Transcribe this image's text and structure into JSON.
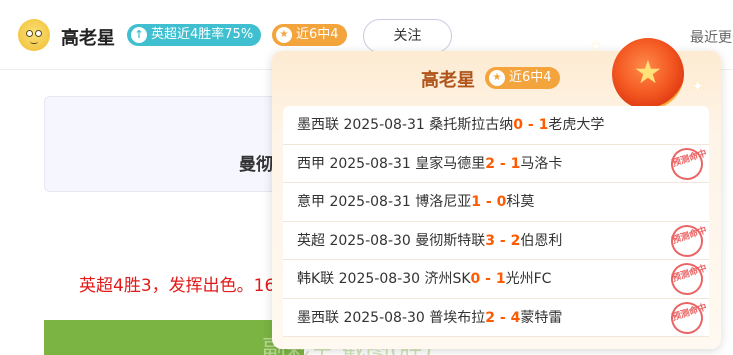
{
  "header": {
    "user_name": "高老星",
    "badge_rate": "英超近4胜率75%",
    "badge_streak": "近6中4",
    "follow_label": "关注",
    "recent_label": "最近更"
  },
  "background": {
    "card_text": "曼彻",
    "red_text": "英超4胜3，发挥出色。16",
    "green_text": "副彩生 截图(胜)"
  },
  "popup": {
    "name": "高老星",
    "badge": "近6中4",
    "stamp_text": "预测命中",
    "matches": [
      {
        "league": "墨西联",
        "date": "2025-08-31",
        "home": "桑托斯拉古纳",
        "home_score": "0",
        "sep": " - ",
        "away_score": "1",
        "away": "老虎大学",
        "hit": false
      },
      {
        "league": "西甲",
        "date": "2025-08-31",
        "home": "皇家马德里",
        "home_score": "2",
        "sep": " - ",
        "away_score": "1",
        "away": "马洛卡",
        "hit": true
      },
      {
        "league": "意甲",
        "date": "2025-08-31",
        "home": "博洛尼亚",
        "home_score": "1",
        "sep": " - ",
        "away_score": "0",
        "away": "科莫",
        "hit": false
      },
      {
        "league": "英超",
        "date": "2025-08-30",
        "home": "曼彻斯特联",
        "home_score": "3",
        "sep": " - ",
        "away_score": "2",
        "away": "伯恩利",
        "hit": true
      },
      {
        "league": "韩K联",
        "date": "2025-08-30",
        "home": "济州SK",
        "home_score": "0",
        "sep": " - ",
        "away_score": "1",
        "away": "光州FC",
        "hit": true
      },
      {
        "league": "墨西联",
        "date": "2025-08-30",
        "home": "普埃布拉",
        "home_score": "2",
        "sep": " - ",
        "away_score": "4",
        "away": "蒙特雷",
        "hit": true
      }
    ]
  }
}
